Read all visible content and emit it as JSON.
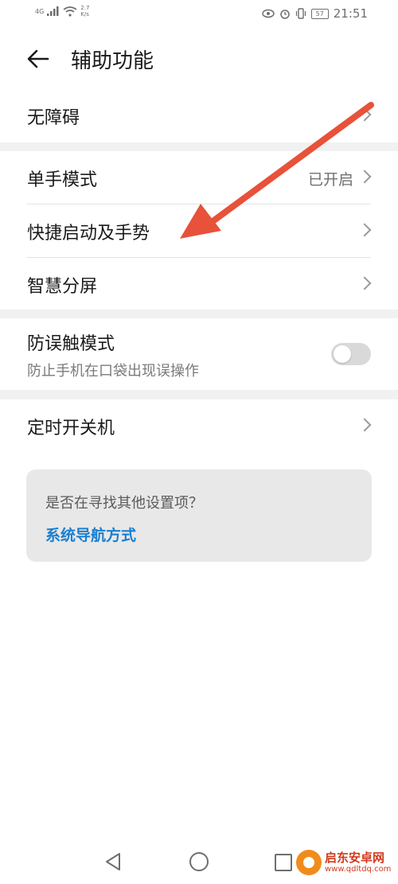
{
  "status_bar": {
    "signal": "4G",
    "net_speed_value": "2.7",
    "net_speed_unit": "K/s",
    "battery": "57",
    "time": "21:51"
  },
  "header": {
    "title": "辅助功能"
  },
  "items": {
    "accessibility": {
      "title": "无障碍"
    },
    "one_handed": {
      "title": "单手模式",
      "value": "已开启"
    },
    "shortcuts": {
      "title": "快捷启动及手势"
    },
    "split_screen": {
      "title": "智慧分屏"
    },
    "pocket_mode": {
      "title": "防误触模式",
      "subtitle": "防止手机在口袋出现误操作",
      "enabled": false
    },
    "scheduled_power": {
      "title": "定时开关机"
    }
  },
  "suggestion": {
    "question": "是否在寻找其他设置项？",
    "link": "系统导航方式"
  },
  "watermark": {
    "name": "启东安卓网",
    "url": "www.qdltdq.com"
  },
  "colors": {
    "accent": "#1a7fd0",
    "arrow": "#e8513a",
    "background": "#f1f1f1"
  },
  "icons": {
    "back": "arrow-left-icon",
    "chevron": "chevron-right-icon",
    "nav_back": "triangle-back-icon",
    "nav_home": "circle-home-icon",
    "nav_recent": "square-recent-icon"
  }
}
